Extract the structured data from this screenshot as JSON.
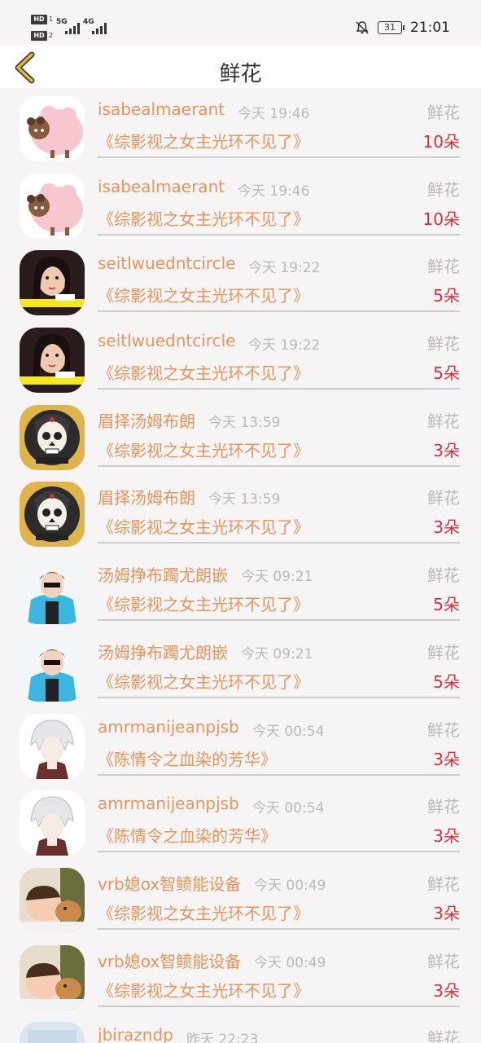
{
  "status_bar": {
    "hd1": "HD",
    "hd1_num": "1",
    "hd2": "HD",
    "hd2_num": "2",
    "net1": "5G",
    "net2": "4G",
    "battery": "31",
    "time": "21:01",
    "icons": [
      "signal-icon",
      "bell-off-icon",
      "battery-icon"
    ]
  },
  "header": {
    "title": "鲜花",
    "back_icon": "chevron-left-icon",
    "accent_color": "#e8b62e"
  },
  "colors": {
    "name": "#e8955a",
    "time": "#bdb7b8",
    "quantity": "#d92f3c"
  },
  "items": [
    {
      "name": "isabealmaerant",
      "time": "今天 19:46",
      "gift": "鲜花",
      "book": "《综影视之女主光环不见了》",
      "quantity": "10朵",
      "avatar": "sheep-avatar"
    },
    {
      "name": "isabealmaerant",
      "time": "今天 19:46",
      "gift": "鲜花",
      "book": "《综影视之女主光环不见了》",
      "quantity": "10朵",
      "avatar": "sheep-avatar"
    },
    {
      "name": "seitlwuedntcircle",
      "time": "今天 19:22",
      "gift": "鲜花",
      "book": "《综影视之女主光环不见了》",
      "quantity": "5朵",
      "avatar": "girl-avatar"
    },
    {
      "name": "seitlwuedntcircle",
      "time": "今天 19:22",
      "gift": "鲜花",
      "book": "《综影视之女主光环不见了》",
      "quantity": "5朵",
      "avatar": "girl-avatar"
    },
    {
      "name": "眉择汤姆布朗",
      "time": "今天 13:59",
      "gift": "鲜花",
      "book": "《综影视之女主光环不见了》",
      "quantity": "3朵",
      "avatar": "skull-avatar"
    },
    {
      "name": "眉择汤姆布朗",
      "time": "今天 13:59",
      "gift": "鲜花",
      "book": "《综影视之女主光环不见了》",
      "quantity": "3朵",
      "avatar": "skull-avatar"
    },
    {
      "name": "汤姆挣布躅尤朗嵌",
      "time": "今天 09:21",
      "gift": "鲜花",
      "book": "《综影视之女主光环不见了》",
      "quantity": "5朵",
      "avatar": "boy-avatar"
    },
    {
      "name": "汤姆挣布躅尤朗嵌",
      "time": "今天 09:21",
      "gift": "鲜花",
      "book": "《综影视之女主光环不见了》",
      "quantity": "5朵",
      "avatar": "boy-avatar"
    },
    {
      "name": "amrmanijeanpjsb",
      "time": "今天 00:54",
      "gift": "鲜花",
      "book": "《陈情令之血染的芳华》",
      "quantity": "3朵",
      "avatar": "anime-avatar"
    },
    {
      "name": "amrmanijeanpjsb",
      "time": "今天 00:54",
      "gift": "鲜花",
      "book": "《陈情令之血染的芳华》",
      "quantity": "3朵",
      "avatar": "anime-avatar"
    },
    {
      "name": "vrb媳ox智鲼能设备",
      "time": "今天 00:49",
      "gift": "鲜花",
      "book": "《综影视之女主光环不见了》",
      "quantity": "3朵",
      "avatar": "baby-dog-avatar"
    },
    {
      "name": "vrb媳ox智鲼能设备",
      "time": "今天 00:49",
      "gift": "鲜花",
      "book": "《综影视之女主光环不见了》",
      "quantity": "3朵",
      "avatar": "baby-dog-avatar"
    },
    {
      "name": "jbirazndp",
      "time": "昨天 22:23",
      "gift": "鲜花",
      "book": "",
      "quantity": "",
      "avatar": "text-avatar"
    }
  ]
}
